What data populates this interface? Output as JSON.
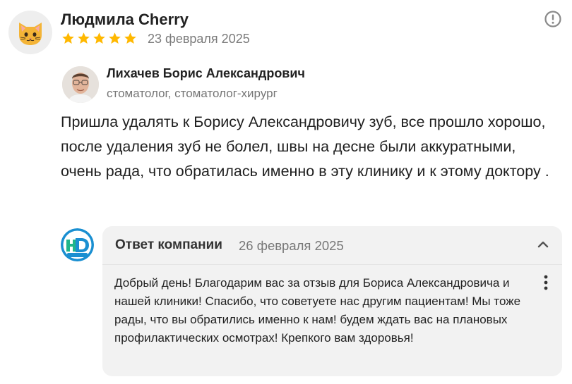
{
  "review": {
    "author_name": "Людмила Cherry",
    "avatar_icon": "cat-face-icon",
    "rating": 5,
    "rating_max": 5,
    "date": "23 февраля 2025",
    "report_icon": "exclamation-circle-icon",
    "doctor": {
      "name": "Лихачев Борис Александрович",
      "specialty": "стоматолог, стоматолог-хирург"
    },
    "text": "Пришла удалять к Борису Александровичу зуб, все прошло хорошо, после удаления зуб не болел, швы на десне были аккуратными, очень рада, что обратилась именно в эту клинику и к этому доктору ."
  },
  "reply": {
    "title": "Ответ компании",
    "date": "26 февраля 2025",
    "logo_icon": "clinic-logo-icon",
    "text": "Добрый день! Благодарим вас за отзыв для Бориса Александровича и нашей клиники! Спасибо, что советуете нас другим пациентам! Мы тоже рады, что вы обратились именно к нам! будем ждать вас на плановых профилактических осмотрах! Крепкого вам здоровья!",
    "collapse_icon": "chevron-up-icon",
    "menu_icon": "more-vertical-icon"
  },
  "colors": {
    "star": "#FFB800",
    "reply_background": "#F2F2F2",
    "muted_text": "#767676",
    "logo_primary": "#1A8FD1",
    "logo_accent": "#1FB58A"
  }
}
